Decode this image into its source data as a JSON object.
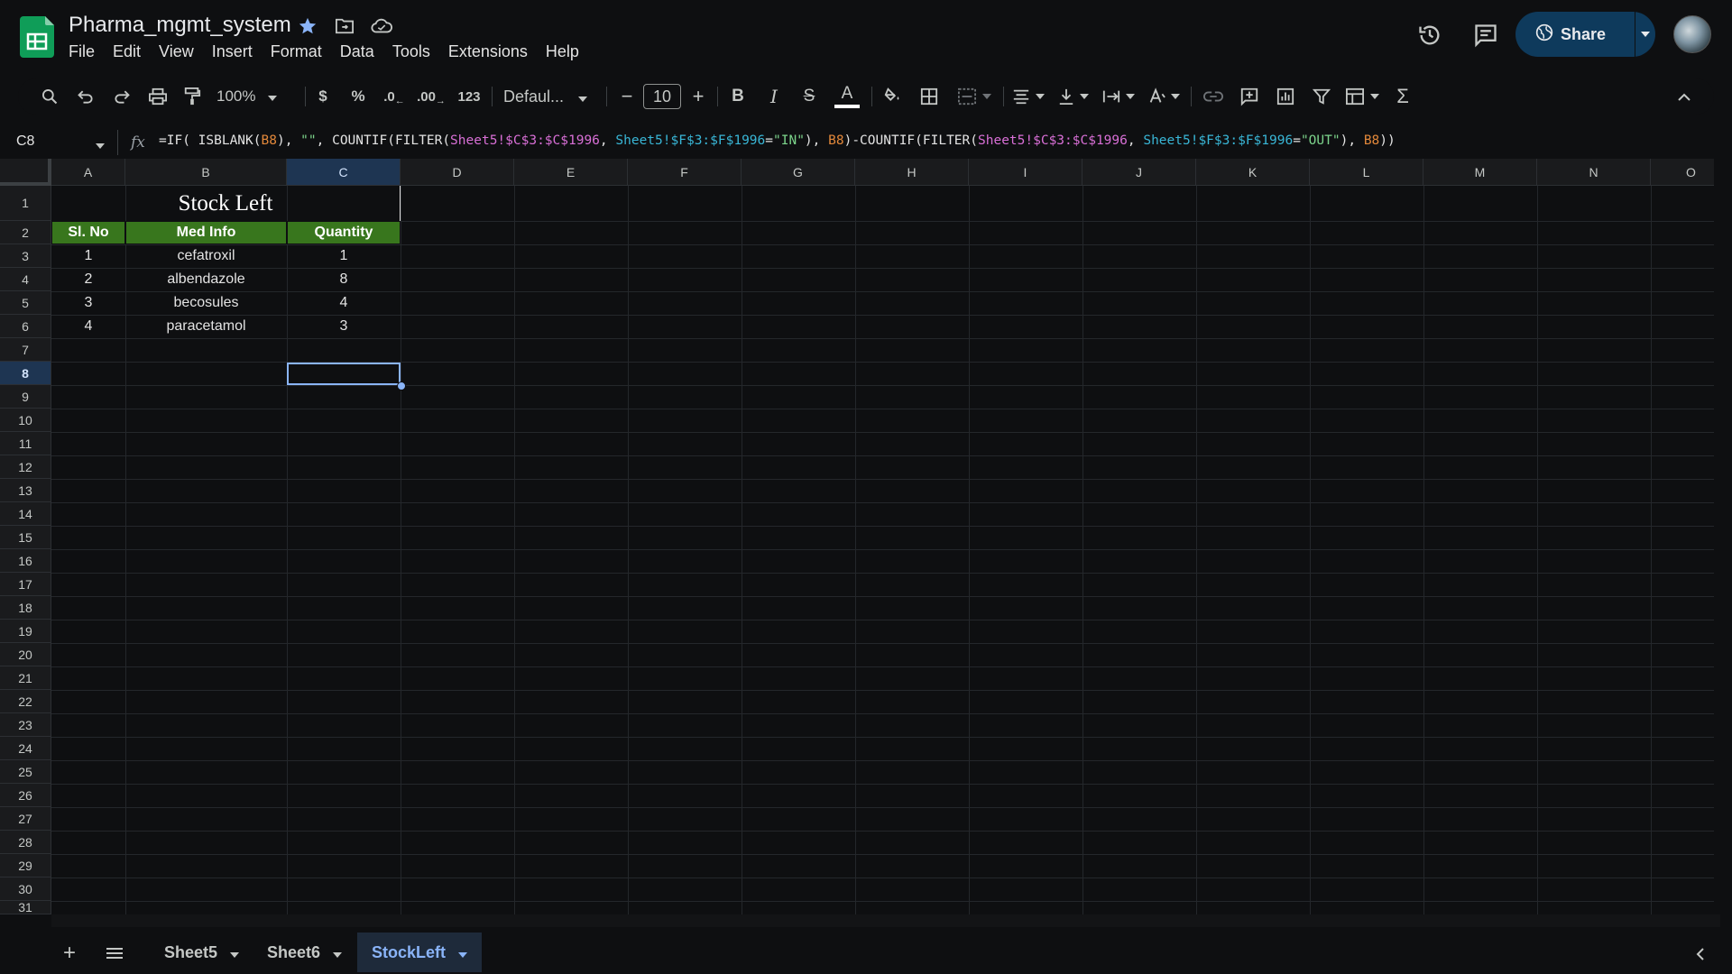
{
  "app": {
    "title": "Pharma_mgmt_system",
    "menu": [
      "File",
      "Edit",
      "View",
      "Insert",
      "Format",
      "Data",
      "Tools",
      "Extensions",
      "Help"
    ],
    "share_label": "Share"
  },
  "toolbar": {
    "zoom": "100%",
    "currency": "$",
    "percent": "%",
    "dec_decrease": ".0",
    "dec_increase": ".00",
    "number_format": "123",
    "font": "Defaul...",
    "font_size": "10",
    "bold": "B",
    "italic": "I",
    "strike": "S",
    "text_color": "A",
    "sum": "Σ"
  },
  "formula_bar": {
    "cell_ref": "C8",
    "fx": "fx",
    "parts": [
      {
        "t": "=IF( ISBLANK(",
        "c": ""
      },
      {
        "t": "B8",
        "c": "orange"
      },
      {
        "t": "), ",
        "c": ""
      },
      {
        "t": "\"\"",
        "c": "green"
      },
      {
        "t": ", COUNTIF(FILTER(",
        "c": ""
      },
      {
        "t": "Sheet5!$C$3:$C$1996",
        "c": "magenta"
      },
      {
        "t": ", ",
        "c": ""
      },
      {
        "t": "Sheet5!$F$3:$F$1996",
        "c": "cyan"
      },
      {
        "t": "=",
        "c": ""
      },
      {
        "t": "\"IN\"",
        "c": "green"
      },
      {
        "t": "), ",
        "c": ""
      },
      {
        "t": "B8",
        "c": "orange"
      },
      {
        "t": ")-COUNTIF(FILTER(",
        "c": ""
      },
      {
        "t": "Sheet5!$C$3:$C$1996",
        "c": "magenta"
      },
      {
        "t": ", ",
        "c": ""
      },
      {
        "t": "Sheet5!$F$3:$F$1996",
        "c": "cyan"
      },
      {
        "t": "=",
        "c": ""
      },
      {
        "t": "\"OUT\"",
        "c": "green"
      },
      {
        "t": "), ",
        "c": ""
      },
      {
        "t": "B8",
        "c": "orange"
      },
      {
        "t": "))",
        "c": ""
      }
    ]
  },
  "grid": {
    "columns": [
      "A",
      "B",
      "C",
      "D",
      "E",
      "F",
      "G",
      "H",
      "I",
      "J",
      "K",
      "L",
      "M",
      "N",
      "O"
    ],
    "rows": [
      "1",
      "2",
      "3",
      "4",
      "5",
      "6",
      "7",
      "8",
      "9",
      "10",
      "11",
      "12",
      "13",
      "14",
      "15",
      "16",
      "17",
      "18",
      "19",
      "20",
      "21",
      "22",
      "23",
      "24",
      "25",
      "26",
      "27",
      "28",
      "29",
      "30",
      "31"
    ],
    "selected_column": "C",
    "selected_row": "8",
    "table_title": "Stock Left",
    "headers": [
      "Sl. No",
      "Med Info",
      "Quantity"
    ],
    "data": [
      [
        "1",
        "cefatroxil",
        "1"
      ],
      [
        "2",
        "albendazole",
        "8"
      ],
      [
        "3",
        "becosules",
        "4"
      ],
      [
        "4",
        "paracetamol",
        "3"
      ]
    ],
    "header_color": "#38761d"
  },
  "sheets": {
    "tabs": [
      "Sheet5",
      "Sheet6",
      "StockLeft"
    ],
    "active": "StockLeft"
  },
  "colors": {
    "accent": "#8ab4f8",
    "share_bg": "#0e3a5c",
    "sheets_green": "#0f9d58"
  }
}
